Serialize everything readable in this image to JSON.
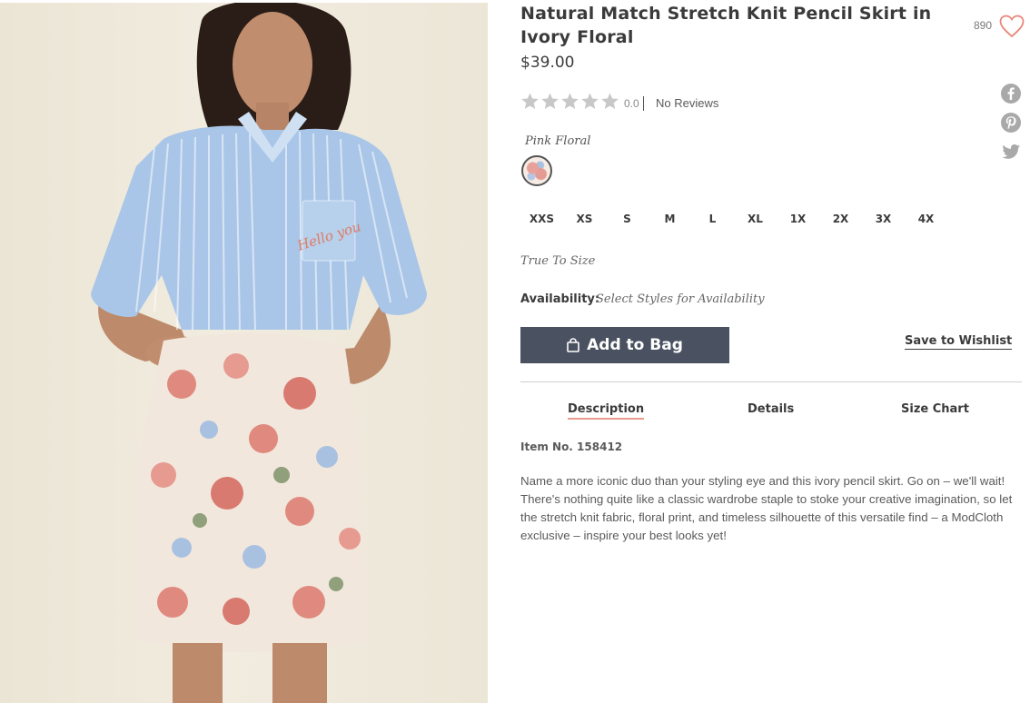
{
  "product": {
    "title": "Natural Match Stretch Knit Pencil Skirt in Ivory Floral",
    "price": "$39.00",
    "favorite_count": "890",
    "item_number": "Item No. 158412",
    "description": "Name a more iconic duo than your styling eye and this ivory pencil skirt. Go on – we'll wait! There's nothing quite like a classic wardrobe staple to stoke your creative imagination, so let the stretch knit fabric, floral print, and timeless silhouette of this versatile find – a ModCloth exclusive – inspire your best looks yet!",
    "shirt_pocket_text": "Hello you"
  },
  "rating": {
    "value": "0.0",
    "reviews_label": "No Reviews",
    "stars_filled": 0,
    "stars_total": 5
  },
  "color": {
    "selected_name": "Pink Floral"
  },
  "sizes": [
    "XXS",
    "XS",
    "S",
    "M",
    "L",
    "XL",
    "1X",
    "2X",
    "3X",
    "4X"
  ],
  "fit_note": "True To Size",
  "availability": {
    "label": "Availability:",
    "value": "Select Styles for Availability"
  },
  "actions": {
    "add_to_bag": "Add to Bag",
    "save_to_wishlist": "Save to Wishlist"
  },
  "tabs": {
    "active": "Description",
    "items": [
      "Description",
      "Details",
      "Size Chart"
    ]
  },
  "share_icons": [
    "facebook-icon",
    "pinterest-icon",
    "twitter-icon"
  ],
  "colors": {
    "button_bg": "#4a5261",
    "heart": "#e8877a",
    "tab_underline": "#e89a8c",
    "star": "#c8c8c8"
  }
}
